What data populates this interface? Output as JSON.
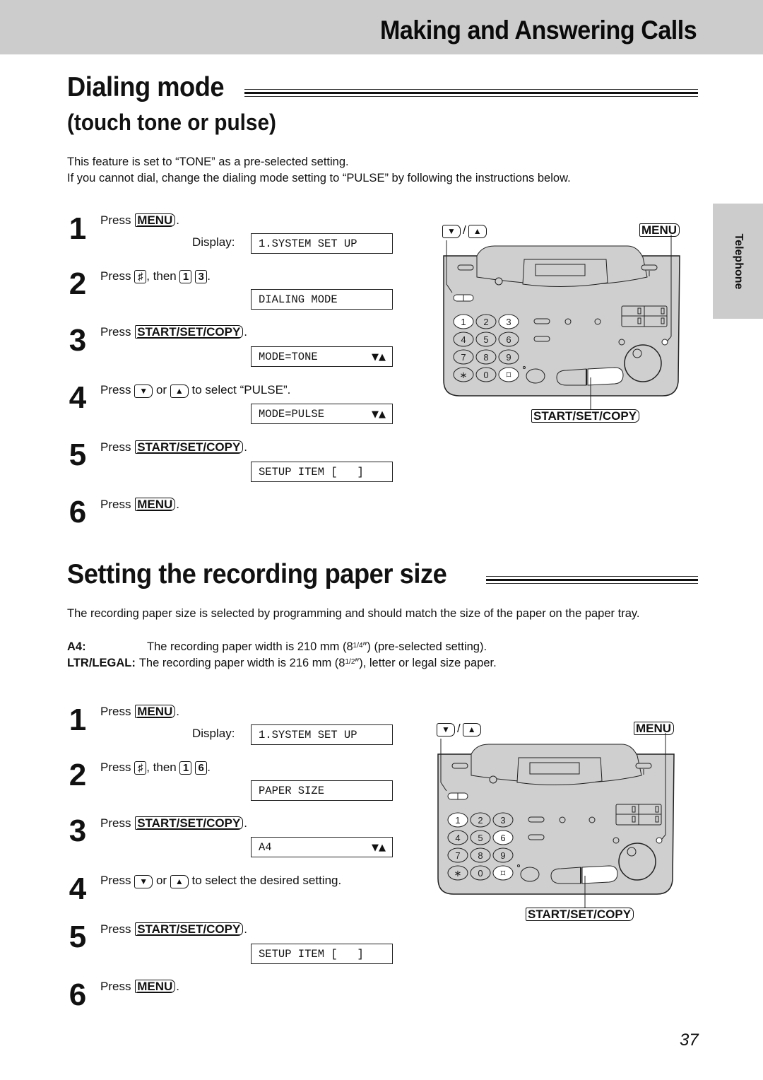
{
  "header": {
    "title": "Making and Answering Calls"
  },
  "side_tab": {
    "label": "Telephone"
  },
  "dialing_mode": {
    "title": "Dialing mode",
    "subtitle": "(touch tone or pulse)",
    "intro": [
      "This feature is set to “TONE” as a pre-selected setting.",
      "If you cannot dial, change the dialing mode setting to “PULSE” by following the instructions below."
    ],
    "steps": [
      {
        "num": "1",
        "press": "Press",
        "key": "MENU",
        "after": ".",
        "display_label": "Display:",
        "lcd": "1.SYSTEM SET UP"
      },
      {
        "num": "2",
        "press": "Press",
        "hash_key": "♯",
        "then": ", then",
        "keys": [
          "1",
          "3"
        ],
        "after": ".",
        "lcd": "DIALING MODE"
      },
      {
        "num": "3",
        "press": "Press",
        "key": "START/SET/COPY",
        "after": ".",
        "lcd": "MODE=TONE",
        "lcd_arrows": "▼▲"
      },
      {
        "num": "4",
        "press": "Press",
        "down_key": "▼",
        "or": "or",
        "up_key": "▲",
        "after": "to select “PULSE”.",
        "lcd": "MODE=PULSE",
        "lcd_arrows": "▼▲"
      },
      {
        "num": "5",
        "press": "Press",
        "key": "START/SET/COPY",
        "after": ".",
        "lcd": "SETUP ITEM [   ]"
      },
      {
        "num": "6",
        "press": "Press",
        "key": "MENU",
        "after": "."
      }
    ],
    "device": {
      "arrow_keys": {
        "down": "▼",
        "sep": "/",
        "up": "▲"
      },
      "menu_label": "MENU",
      "start_label": "START/SET/COPY",
      "highlighted_keys": [
        "1",
        "3",
        "#"
      ]
    }
  },
  "paper_size": {
    "title": "Setting the recording paper size",
    "intro": "The recording paper size is selected by programming and should match the size of the paper on the paper tray.",
    "definitions": [
      {
        "term": "A4:",
        "desc_pre": "The recording paper width is 210 mm (8",
        "frac": "1/4",
        "desc_post": "″) (pre-selected setting)."
      },
      {
        "term": "LTR/LEGAL:",
        "desc_pre": "The recording paper width is 216 mm (8",
        "frac": "1/2",
        "desc_post": "″), letter or legal size paper."
      }
    ],
    "steps": [
      {
        "num": "1",
        "press": "Press",
        "key": "MENU",
        "after": ".",
        "display_label": "Display:",
        "lcd": "1.SYSTEM SET UP"
      },
      {
        "num": "2",
        "press": "Press",
        "hash_key": "♯",
        "then": ", then",
        "keys": [
          "1",
          "6"
        ],
        "after": ".",
        "lcd": "PAPER SIZE"
      },
      {
        "num": "3",
        "press": "Press",
        "key": "START/SET/COPY",
        "after": ".",
        "lcd": "A4",
        "lcd_arrows": "▼▲"
      },
      {
        "num": "4",
        "press": "Press",
        "down_key": "▼",
        "or": "or",
        "up_key": "▲",
        "after": "to select the desired setting."
      },
      {
        "num": "5",
        "press": "Press",
        "key": "START/SET/COPY",
        "after": ".",
        "lcd": "SETUP ITEM [   ]"
      },
      {
        "num": "6",
        "press": "Press",
        "key": "MENU",
        "after": "."
      }
    ],
    "device": {
      "arrow_keys": {
        "down": "▼",
        "sep": "/",
        "up": "▲"
      },
      "menu_label": "MENU",
      "start_label": "START/SET/COPY",
      "highlighted_keys": [
        "1",
        "6",
        "#"
      ]
    }
  },
  "keypad": [
    "1",
    "2",
    "3",
    "4",
    "5",
    "6",
    "7",
    "8",
    "9",
    "∗",
    "0",
    "⌑"
  ],
  "page_number": "37"
}
